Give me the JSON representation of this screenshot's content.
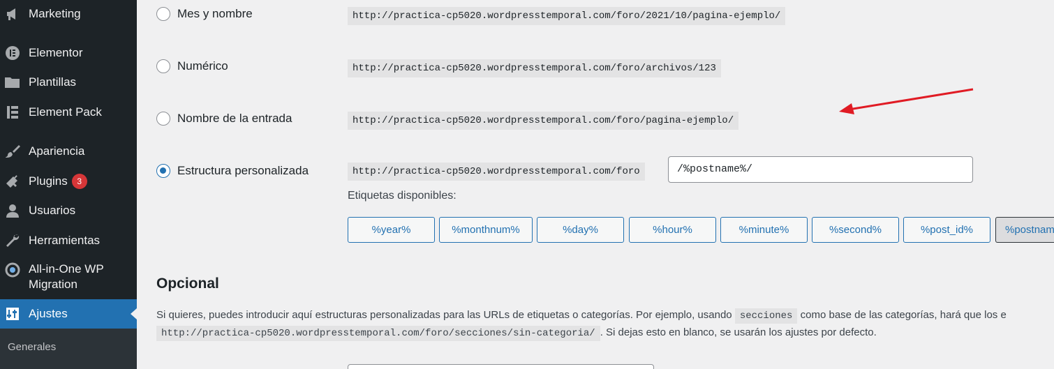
{
  "sidebar": {
    "items": [
      {
        "label": "Marketing",
        "icon": "megaphone-icon"
      },
      {
        "label": "Elementor",
        "icon": "elementor-icon"
      },
      {
        "label": "Plantillas",
        "icon": "folder-icon"
      },
      {
        "label": "Element Pack",
        "icon": "element-pack-icon"
      },
      {
        "label": "Apariencia",
        "icon": "paintbrush-icon"
      },
      {
        "label": "Plugins",
        "icon": "plugin-icon",
        "badge": "3"
      },
      {
        "label": "Usuarios",
        "icon": "user-icon"
      },
      {
        "label": "Herramientas",
        "icon": "wrench-icon"
      },
      {
        "label": "All-in-One WP Migration",
        "icon": "migration-icon"
      },
      {
        "label": "Ajustes",
        "icon": "settings-icon",
        "active": true
      }
    ],
    "submenu": {
      "item": "Generales"
    }
  },
  "permalinks": {
    "options": [
      {
        "label": "Mes y nombre",
        "url": "http://practica-cp5020.wordpresstemporal.com/foro/2021/10/pagina-ejemplo/",
        "checked": false
      },
      {
        "label": "Numérico",
        "url": "http://practica-cp5020.wordpresstemporal.com/foro/archivos/123",
        "checked": false
      },
      {
        "label": "Nombre de la entrada",
        "url": "http://practica-cp5020.wordpresstemporal.com/foro/pagina-ejemplo/",
        "checked": false
      },
      {
        "label": "Estructura personalizada",
        "url": "http://practica-cp5020.wordpresstemporal.com/foro",
        "checked": true
      }
    ],
    "custom_value": "/%postname%/",
    "tags_label": "Etiquetas disponibles:",
    "tags": [
      "%year%",
      "%monthnum%",
      "%day%",
      "%hour%",
      "%minute%",
      "%second%",
      "%post_id%",
      "%postnam"
    ]
  },
  "optional": {
    "title": "Opcional",
    "desc_start": "Si quieres, puedes introducir aquí estructuras personalizadas para las URLs de etiquetas o categorías. Por ejemplo, usando",
    "code1": "secciones",
    "desc_mid": "como base de las categorías, hará que los e",
    "code2": "http://practica-cp5020.wordpresstemporal.com/foro/secciones/sin-categoria/",
    "desc_end": ". Si dejas esto en blanco, se usarán los ajustes por defecto."
  },
  "colors": {
    "accent": "#2271b1",
    "sidebar": "#1d2327",
    "badge": "#d63638",
    "arrow": "#e01b24"
  }
}
